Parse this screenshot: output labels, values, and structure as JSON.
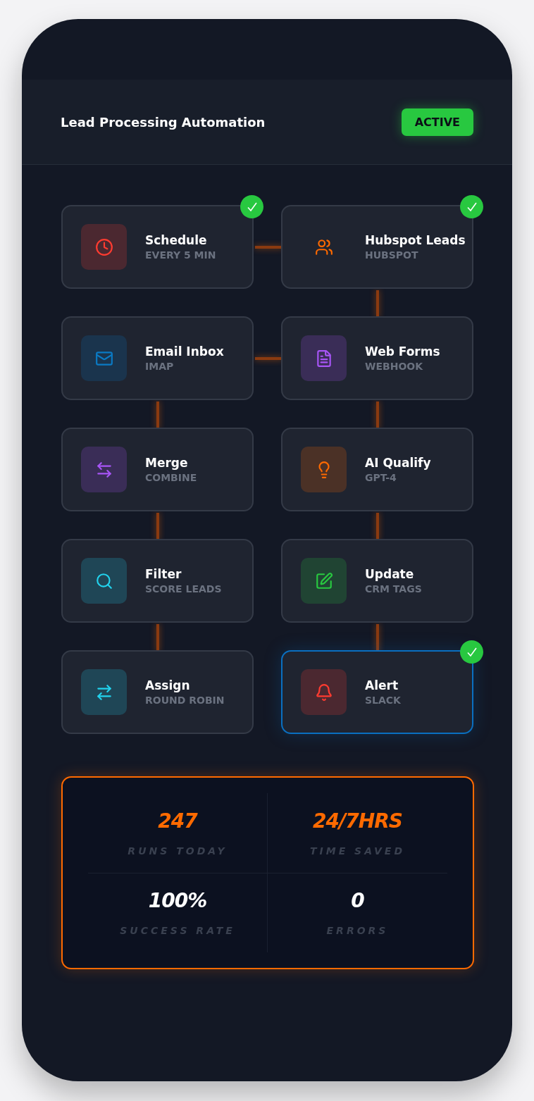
{
  "header": {
    "title": "Lead Processing Automation",
    "status": "ACTIVE"
  },
  "nodes": [
    {
      "title": "Schedule",
      "subtitle": "EVERY 5 MIN",
      "kind": "clock",
      "color": "#ff3b30",
      "tile": true,
      "done": true,
      "selected": false,
      "link_right": true,
      "link_down": false
    },
    {
      "title": "Hubspot Leads",
      "subtitle": "HUBSPOT",
      "kind": "people",
      "color": "#ff6a00",
      "tile": false,
      "done": true,
      "selected": false,
      "link_right": false,
      "link_down": true
    },
    {
      "title": "Email Inbox",
      "subtitle": "IMAP",
      "kind": "mail",
      "color": "#0a7ac4",
      "tile": true,
      "done": false,
      "selected": false,
      "link_right": true,
      "link_down": true
    },
    {
      "title": "Web Forms",
      "subtitle": "WEBHOOK",
      "kind": "document",
      "color": "#a855f7",
      "tile": true,
      "done": false,
      "selected": false,
      "link_right": false,
      "link_down": true
    },
    {
      "title": "Merge",
      "subtitle": "COMBINE",
      "kind": "merge",
      "color": "#a855f7",
      "tile": true,
      "done": false,
      "selected": false,
      "link_right": false,
      "link_down": true
    },
    {
      "title": "AI Qualify",
      "subtitle": "GPT-4",
      "kind": "ai",
      "color": "#ff6a00",
      "tile": true,
      "done": false,
      "selected": false,
      "link_right": false,
      "link_down": true
    },
    {
      "title": "Filter",
      "subtitle": "SCORE LEADS",
      "kind": "filter",
      "color": "#22d3ee",
      "tile": true,
      "done": false,
      "selected": false,
      "link_right": false,
      "link_down": true
    },
    {
      "title": "Update",
      "subtitle": "CRM TAGS",
      "kind": "update",
      "color": "#28c840",
      "tile": true,
      "done": false,
      "selected": false,
      "link_right": false,
      "link_down": true
    },
    {
      "title": "Assign",
      "subtitle": "ROUND ROBIN",
      "kind": "assign",
      "color": "#22d3ee",
      "tile": true,
      "done": false,
      "selected": false,
      "link_right": false,
      "link_down": false
    },
    {
      "title": "Alert",
      "subtitle": "SLACK",
      "kind": "alert",
      "color": "#ff3b30",
      "tile": true,
      "done": true,
      "selected": true,
      "link_right": false,
      "link_down": false
    }
  ],
  "stats": [
    {
      "value": "247",
      "label": "RUNS TODAY",
      "accent": true
    },
    {
      "value": "24/7HRS",
      "label": "TIME SAVED",
      "accent": true
    },
    {
      "value": "100%",
      "label": "SUCCESS RATE",
      "accent": false
    },
    {
      "value": "0",
      "label": "ERRORS",
      "accent": false
    }
  ]
}
